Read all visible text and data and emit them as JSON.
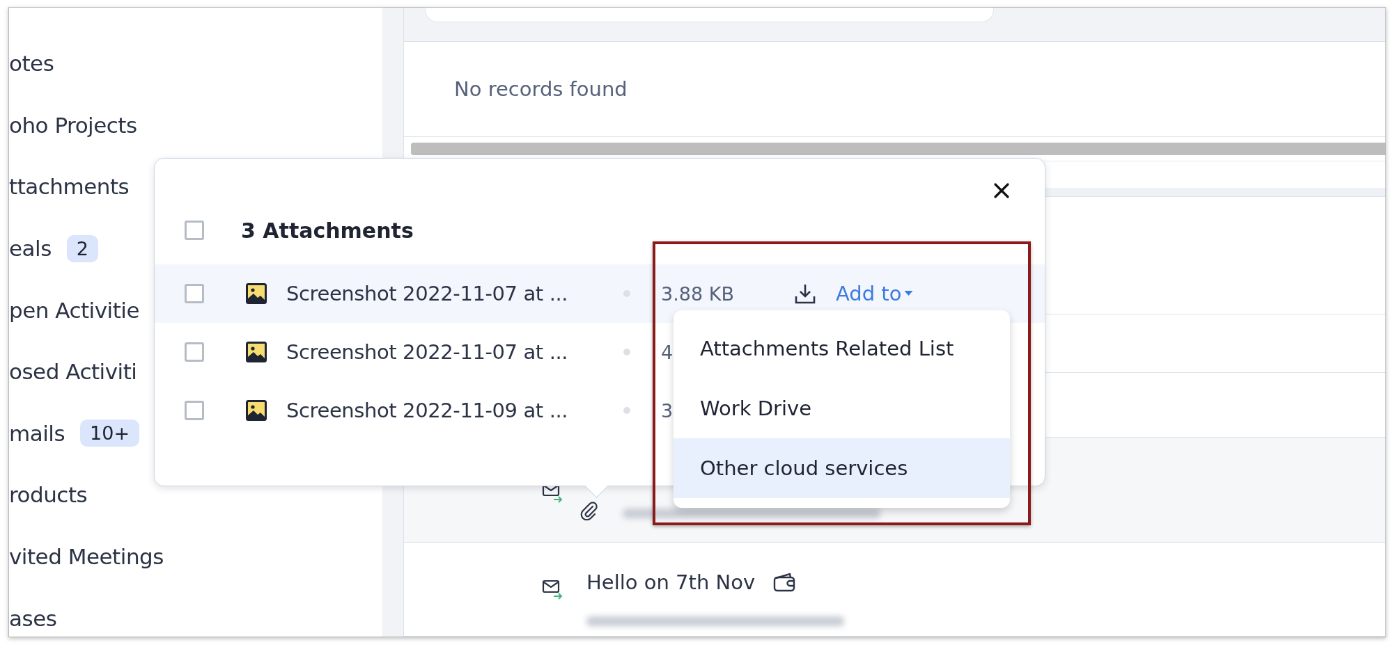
{
  "sidebar": {
    "items": [
      {
        "label": "otes"
      },
      {
        "label": "oho Projects"
      },
      {
        "label": "ttachments"
      },
      {
        "label": "eals",
        "badge": "2"
      },
      {
        "label": "pen Activitie"
      },
      {
        "label": "osed Activiti"
      },
      {
        "label": "mails",
        "badge": "10+"
      },
      {
        "label": "roducts"
      },
      {
        "label": "vited Meetings"
      },
      {
        "label": "ases"
      }
    ]
  },
  "records": {
    "empty_message": "No records found"
  },
  "emails": [
    {
      "kind": "attachment"
    },
    {
      "kind": "card",
      "subject": "Hello on 7th Nov"
    }
  ],
  "attachments_popup": {
    "title": "3 Attachments",
    "select_all_checked": false,
    "files": [
      {
        "name": "Screenshot 2022-11-07 at ...",
        "size": "3.88 KB",
        "checked": false,
        "selected": true
      },
      {
        "name": "Screenshot 2022-11-07 at ...",
        "size": "4",
        "checked": false,
        "selected": false
      },
      {
        "name": "Screenshot 2022-11-09 at ...",
        "size": "3",
        "checked": false,
        "selected": false
      }
    ],
    "add_to": "Add to",
    "menu_highlighted": true,
    "menu": [
      {
        "label": "Attachments Related List",
        "selected": false
      },
      {
        "label": "Work Drive",
        "selected": false
      },
      {
        "label": "Other cloud services",
        "selected": true
      }
    ]
  }
}
